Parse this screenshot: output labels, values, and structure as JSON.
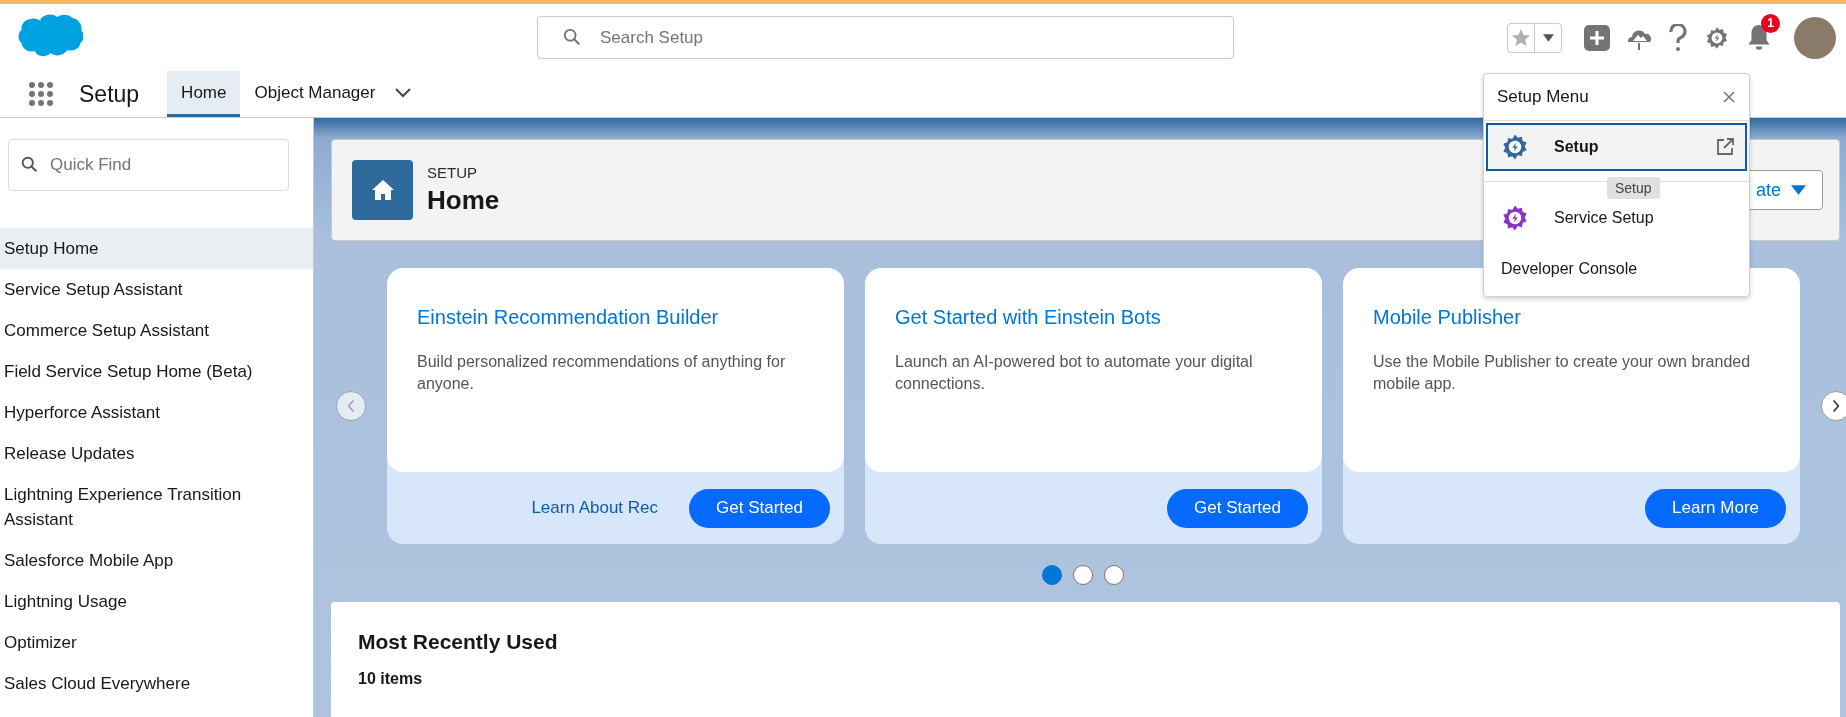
{
  "header": {
    "search": {
      "placeholder": "Search Setup"
    },
    "notification_count": "1"
  },
  "nav": {
    "app_name": "Setup",
    "tabs": [
      {
        "label": "Home",
        "selected": true
      },
      {
        "label": "Object Manager",
        "selected": false
      }
    ]
  },
  "sidebar": {
    "search": {
      "placeholder": "Quick Find"
    },
    "items": [
      {
        "label": "Setup Home",
        "selected": true
      },
      {
        "label": "Service Setup Assistant",
        "selected": false
      },
      {
        "label": "Commerce Setup Assistant",
        "selected": false
      },
      {
        "label": "Field Service Setup Home (Beta)",
        "selected": false
      },
      {
        "label": "Hyperforce Assistant",
        "selected": false
      },
      {
        "label": "Release Updates",
        "selected": false
      },
      {
        "label": "Lightning Experience Transition Assistant",
        "selected": false
      },
      {
        "label": "Salesforce Mobile App",
        "selected": false
      },
      {
        "label": "Lightning Usage",
        "selected": false
      },
      {
        "label": "Optimizer",
        "selected": false
      },
      {
        "label": "Sales Cloud Everywhere",
        "selected": false
      }
    ]
  },
  "page_header": {
    "eyebrow": "SETUP",
    "title": "Home",
    "button": "ate"
  },
  "carousel": {
    "cards": [
      {
        "title": "Einstein Recommendation Builder",
        "description": "Build personalized recommendations of anything for anyone.",
        "link": "Learn About Rec",
        "button": "Get Started"
      },
      {
        "title": "Get Started with Einstein Bots",
        "description": "Launch an AI-powered bot to automate your digital connections.",
        "button": "Get Started"
      },
      {
        "title": "Mobile Publisher",
        "description": "Use the Mobile Publisher to create your own branded mobile app.",
        "button": "Learn More"
      }
    ],
    "pages": [
      {
        "selected": true
      },
      {
        "selected": false
      },
      {
        "selected": false
      }
    ]
  },
  "recent": {
    "title": "Most Recently Used",
    "count": "10 items"
  },
  "setup_menu": {
    "title": "Setup Menu",
    "tooltip": "Setup",
    "items": [
      {
        "kind": "app",
        "label": "Setup",
        "selected": true,
        "color": "#2e6b9c"
      },
      {
        "kind": "app",
        "label": "Service Setup",
        "selected": false,
        "color": "#8a33c7"
      },
      {
        "kind": "link",
        "label": "Developer Console",
        "selected": false
      }
    ]
  }
}
